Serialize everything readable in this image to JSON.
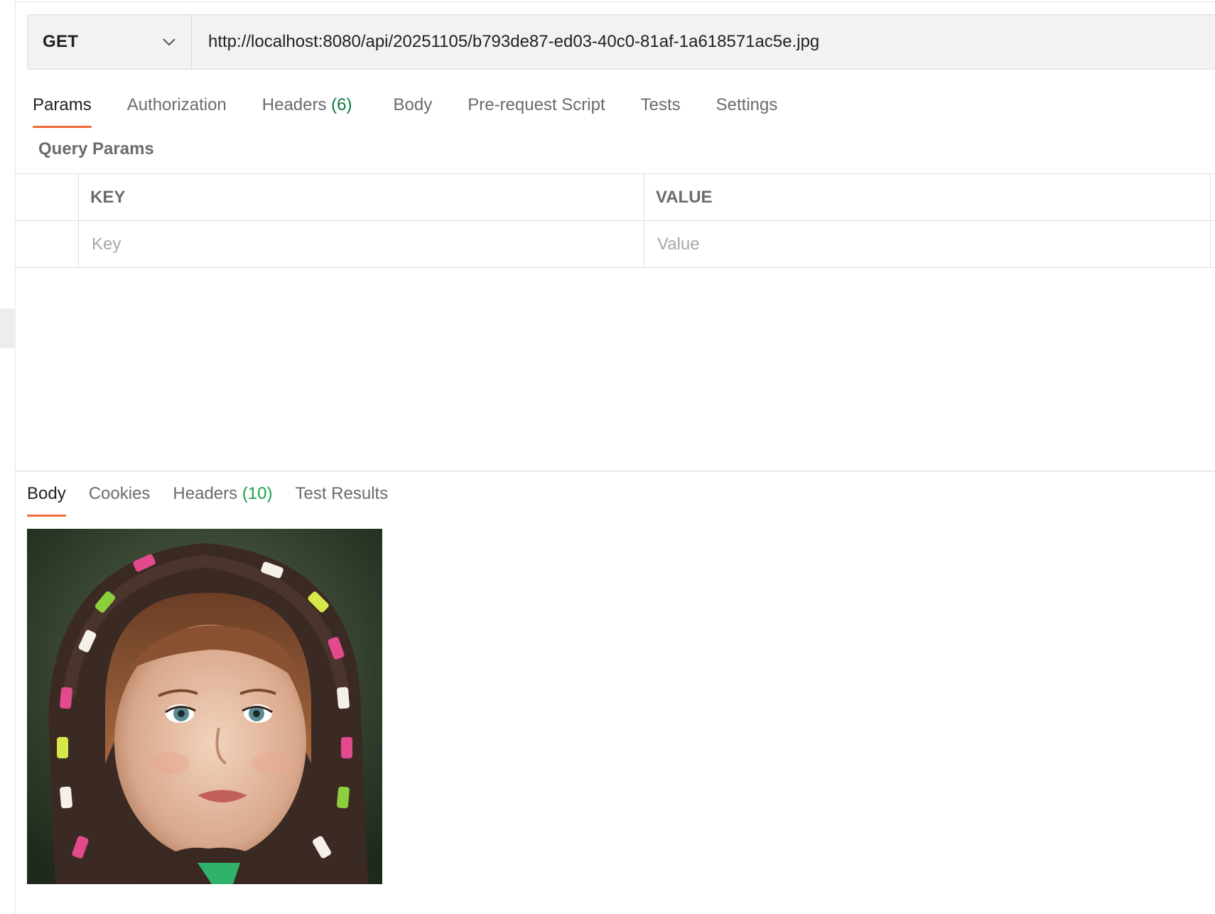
{
  "request": {
    "method": "GET",
    "url": "http://localhost:8080/api/20251105/b793de87-ed03-40c0-81af-1a618571ac5e.jpg"
  },
  "request_tabs": [
    {
      "label": "Params",
      "count": "",
      "active": true
    },
    {
      "label": "Authorization",
      "count": ""
    },
    {
      "label": "Headers",
      "count": "(6)"
    },
    {
      "label": "Body",
      "count": ""
    },
    {
      "label": "Pre-request Script",
      "count": ""
    },
    {
      "label": "Tests",
      "count": ""
    },
    {
      "label": "Settings",
      "count": ""
    }
  ],
  "query_params": {
    "title": "Query Params",
    "columns": [
      "KEY",
      "VALUE"
    ],
    "key_placeholder": "Key",
    "value_placeholder": "Value"
  },
  "response_tabs": [
    {
      "label": "Body",
      "count": "",
      "active": true
    },
    {
      "label": "Cookies",
      "count": ""
    },
    {
      "label": "Headers",
      "count": "(10)"
    },
    {
      "label": "Test Results",
      "count": ""
    }
  ],
  "colors": {
    "accent": "#f26b3a",
    "count_green": "#0c7a3c",
    "count_green_bright": "#1aa24c"
  }
}
